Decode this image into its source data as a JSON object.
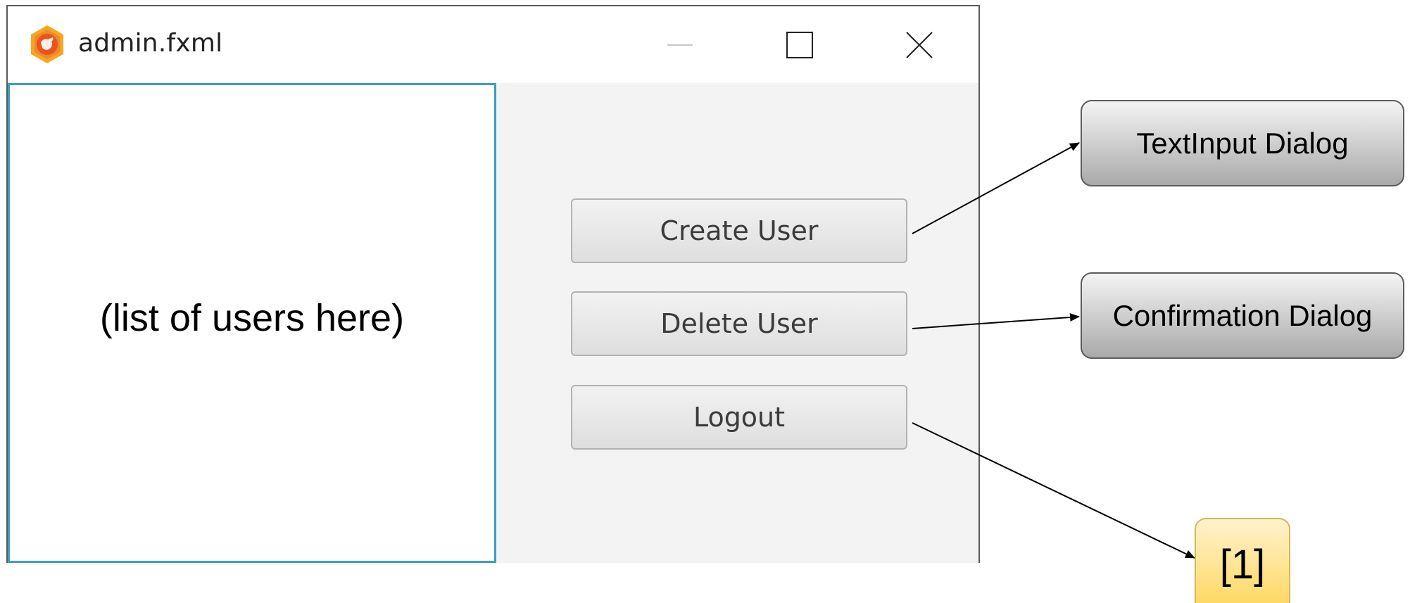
{
  "window": {
    "title": "admin.fxml",
    "icon": "app-logo-icon",
    "controls": {
      "minimize": "minimize-icon",
      "maximize": "maximize-icon",
      "close": "close-icon"
    }
  },
  "list": {
    "placeholder": "(list of users here)"
  },
  "buttons": {
    "create": "Create User",
    "delete": "Delete User",
    "logout": "Logout"
  },
  "annotations": {
    "textinput_dialog": "TextInput Dialog",
    "confirmation_dialog": "Confirmation Dialog",
    "reference": "[1]"
  },
  "colors": {
    "list_border": "#3aa0c4",
    "pane_background": "#f3f3f3",
    "reference_fill": "#ffd966",
    "icon_orange": "#f5a623"
  }
}
